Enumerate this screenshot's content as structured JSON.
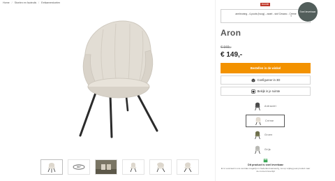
{
  "breadcrumb": {
    "items": [
      "Home",
      "/",
      "Stoelen en fauteuils",
      "/",
      "Eetkamerstoelen"
    ]
  },
  "product": {
    "title": "Aron",
    "old_price": "€ 169,-",
    "price": "€ 149,-"
  },
  "finish": {
    "badge": "KLEUR",
    "text": "armleuning - 4-poots (hoog) - zwart - stof Cesano - Crème",
    "stock_badge": "Snel leverbaar"
  },
  "actions": {
    "order_label": "Bestellen in de winkel",
    "configure_label": "Configureer in 3D",
    "view_label": "Bekijk in je ruimte"
  },
  "colors": [
    {
      "label": "Antraciet",
      "hex": "#4a4a4a"
    },
    {
      "label": "Crème",
      "hex": "#e4ddd2"
    },
    {
      "label": "Groen",
      "hex": "#6e6f4c"
    },
    {
      "label": "Grijs",
      "hex": "#b9b9b4"
    }
  ],
  "thumbnails": [
    {
      "icon": "chair-icon"
    },
    {
      "icon": "rotate-360-icon",
      "label": "360°"
    },
    {
      "icon": "room-photo"
    },
    {
      "icon": "chair-icon"
    },
    {
      "icon": "chair-icon"
    },
    {
      "icon": "chair-icon"
    }
  ],
  "delivery": {
    "title": "Dit product is snel leverbaar",
    "text": "Er is voorraad in ons centrale magazijn in Nederland aanwezig, zet op vrijdag jouw product naar de moment levertijd"
  },
  "theme": {
    "accent": "#f39200",
    "badge_red": "#c0392b",
    "stock_circle": "#525e5b"
  }
}
